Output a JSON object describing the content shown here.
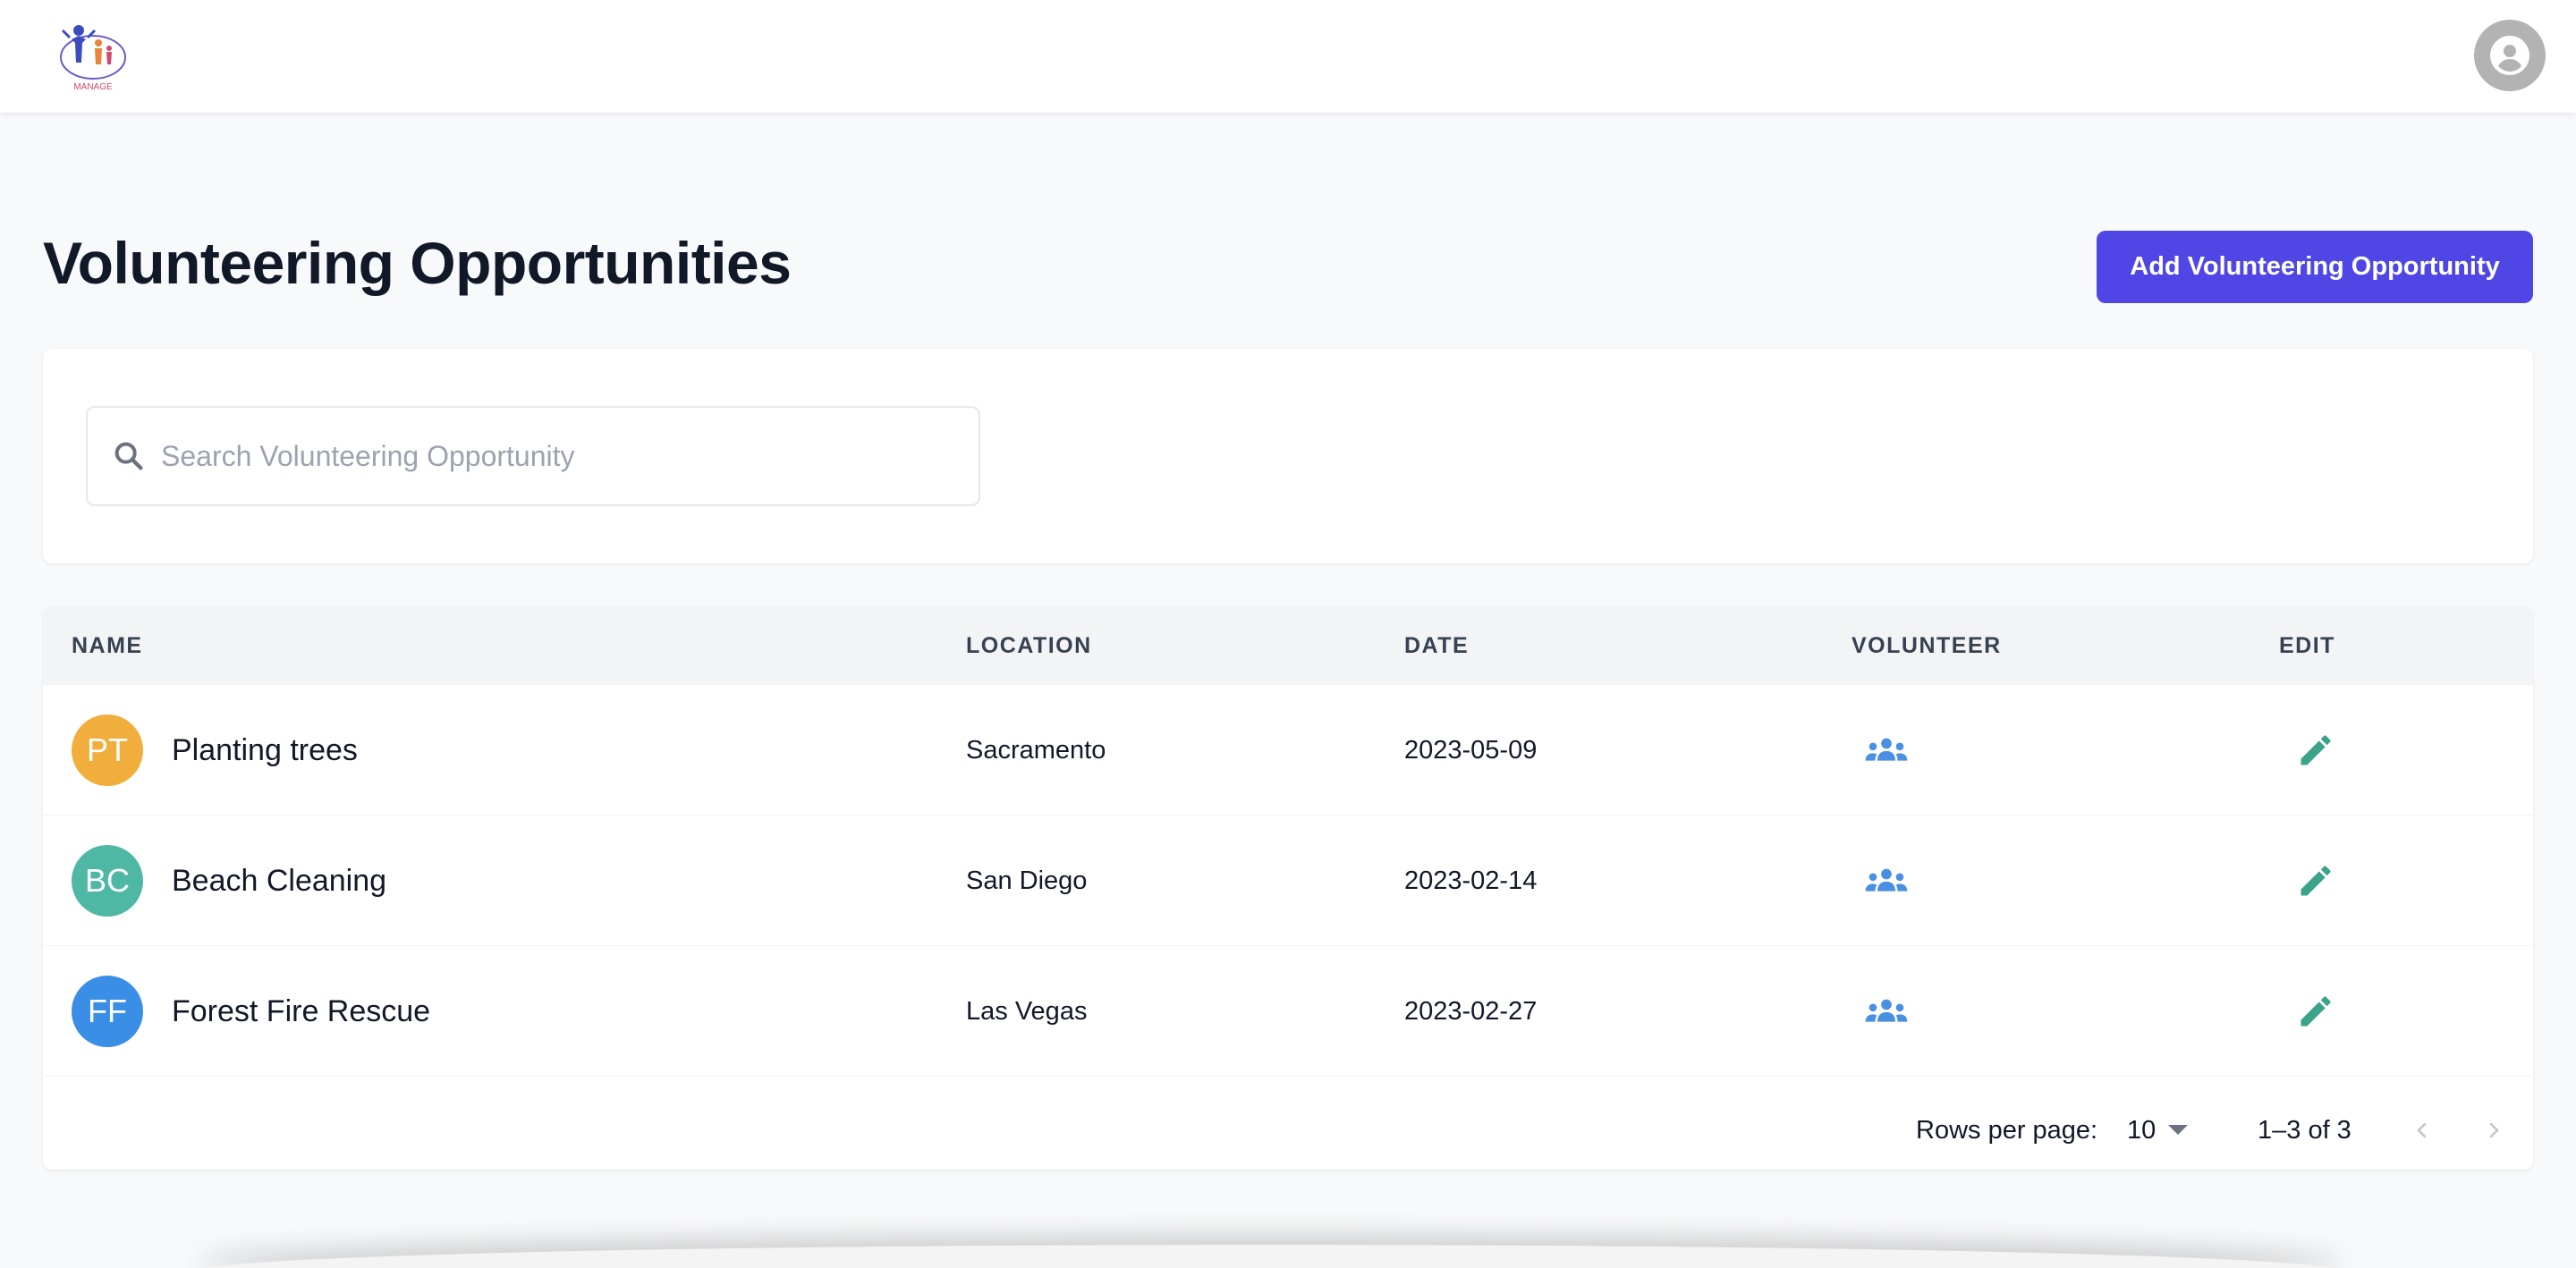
{
  "header": {
    "logo_text": "MANAGE",
    "profile_icon": "account-circle-icon"
  },
  "page": {
    "title": "Volunteering Opportunities",
    "add_button_label": "Add Volunteering Opportunity",
    "accent_color": "#4f46e5"
  },
  "search": {
    "placeholder": "Search Volunteering Opportunity",
    "value": "",
    "icon": "search-icon"
  },
  "table": {
    "columns": {
      "name": "NAME",
      "location": "LOCATION",
      "date": "DATE",
      "volunteer": "VOLUNTEER",
      "edit": "EDIT"
    },
    "rows": [
      {
        "initials": "PT",
        "name": "Planting trees",
        "location": "Sacramento",
        "date": "2023-05-09",
        "avatar_color": "#f2ae3d",
        "volunteer_icon": "group-icon",
        "edit_icon": "pencil-icon"
      },
      {
        "initials": "BC",
        "name": "Beach Cleaning",
        "location": "San Diego",
        "date": "2023-02-14",
        "avatar_color": "#4fb8a4",
        "volunteer_icon": "group-icon",
        "edit_icon": "pencil-icon"
      },
      {
        "initials": "FF",
        "name": "Forest Fire Rescue",
        "location": "Las Vegas",
        "date": "2023-02-27",
        "avatar_color": "#3b8ee6",
        "volunteer_icon": "group-icon",
        "edit_icon": "pencil-icon"
      }
    ],
    "icon_colors": {
      "volunteer": "#4a90e2",
      "edit": "#3aa38a"
    }
  },
  "pagination": {
    "rows_per_page_label": "Rows per page:",
    "rows_per_page_value": "10",
    "range_label": "1–3 of 3",
    "prev_icon": "chevron-left-icon",
    "next_icon": "chevron-right-icon"
  }
}
